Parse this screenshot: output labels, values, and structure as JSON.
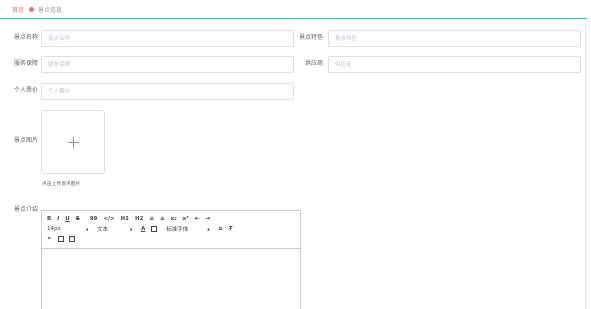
{
  "breadcrumb": {
    "home": "首页",
    "current": "景点信息"
  },
  "form": {
    "name": {
      "label": "景点名称",
      "placeholder": "景点名称"
    },
    "feature": {
      "label": "景点特色",
      "placeholder": "景点特色"
    },
    "service": {
      "label": "服务保障",
      "placeholder": "服务保障"
    },
    "supplier": {
      "label": "供应商",
      "placeholder": "供应商"
    },
    "price": {
      "label": "个人票价",
      "placeholder": "个人票价"
    },
    "image": {
      "label": "景点图片",
      "hint": "点击上传景点图片"
    },
    "intro": {
      "label": "景点介绍"
    }
  },
  "editor": {
    "row1": [
      "B",
      "I",
      "U",
      "S",
      "99",
      "</>",
      "H1",
      "H2",
      "≡",
      "≡",
      "x₂",
      "x²",
      "⇤",
      "⇥"
    ],
    "size": "14px",
    "block": "文本",
    "color_a": "A",
    "font": "标准字体",
    "caret": "♦"
  },
  "colors": {
    "accent": "#55b5a6",
    "home": "#f56c6c"
  }
}
